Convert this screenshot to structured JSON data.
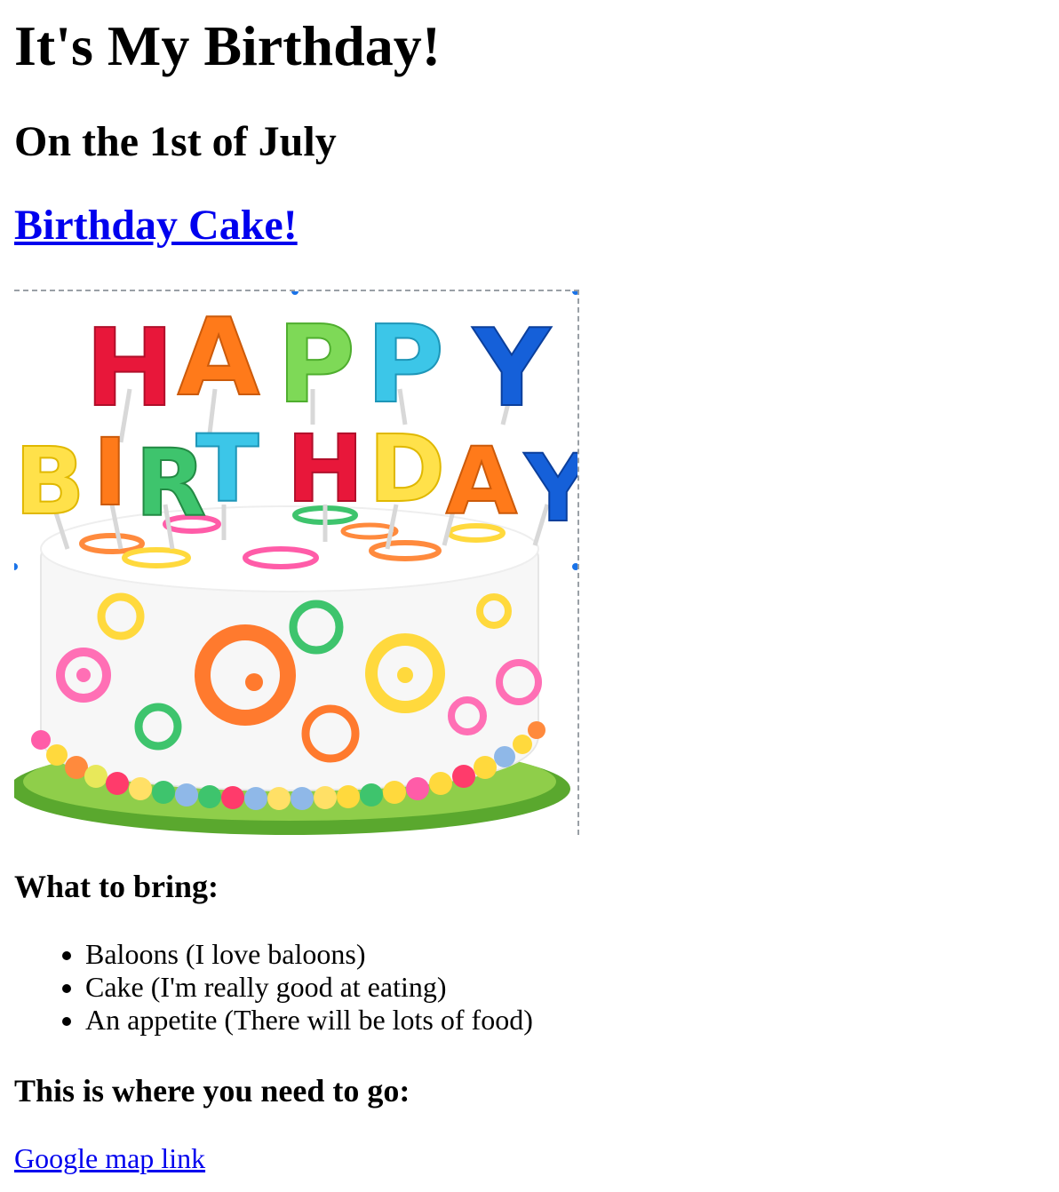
{
  "heading": "It's My Birthday!",
  "subheading": "On the 1st of July",
  "cake_link": "Birthday Cake!",
  "image": {
    "alt": "Happy Birthday cake",
    "candle_letters_row1": [
      "H",
      "A",
      "P",
      "P",
      "Y"
    ],
    "candle_letters_row2": [
      "B",
      "I",
      "R",
      "T",
      "H",
      "D",
      "A",
      "Y"
    ]
  },
  "bring_title": "What to bring:",
  "bring_items": [
    "Baloons (I love baloons)",
    "Cake (I'm really good at eating)",
    "An appetite (There will be lots of food)"
  ],
  "go_title": "This is where you need to go:",
  "map_link": "Google map link",
  "colors": {
    "link": "#0000ee",
    "selection_handle": "#1a73e8"
  }
}
